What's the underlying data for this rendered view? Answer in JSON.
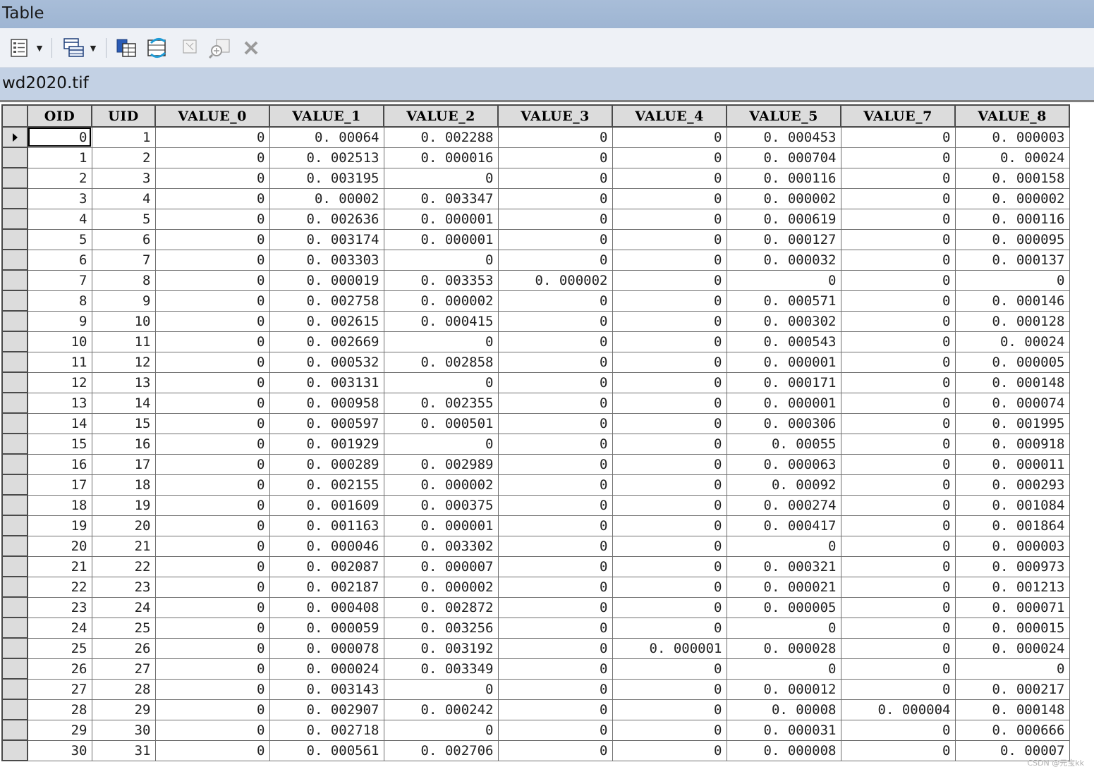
{
  "window": {
    "title": "Table"
  },
  "toolbar": {
    "buttons": [
      {
        "name": "table-options-icon",
        "dropdown": true
      },
      {
        "name": "related-tables-icon",
        "dropdown": true
      },
      {
        "name": "select-by-attributes-icon"
      },
      {
        "name": "switch-selection-icon"
      },
      {
        "name": "clear-selection-icon"
      },
      {
        "name": "zoom-to-selected-icon"
      },
      {
        "name": "delete-selected-icon"
      }
    ]
  },
  "tab": {
    "label": "wd2020.tif"
  },
  "table": {
    "columns": [
      "OID",
      "UID",
      "VALUE_0",
      "VALUE_1",
      "VALUE_2",
      "VALUE_3",
      "VALUE_4",
      "VALUE_5",
      "VALUE_7",
      "VALUE_8"
    ],
    "rows": [
      [
        "0",
        "1",
        "0",
        "0. 00064",
        "0. 002288",
        "0",
        "0",
        "0. 000453",
        "0",
        "0. 000003"
      ],
      [
        "1",
        "2",
        "0",
        "0. 002513",
        "0. 000016",
        "0",
        "0",
        "0. 000704",
        "0",
        "0. 00024"
      ],
      [
        "2",
        "3",
        "0",
        "0. 003195",
        "0",
        "0",
        "0",
        "0. 000116",
        "0",
        "0. 000158"
      ],
      [
        "3",
        "4",
        "0",
        "0. 00002",
        "0. 003347",
        "0",
        "0",
        "0. 000002",
        "0",
        "0. 000002"
      ],
      [
        "4",
        "5",
        "0",
        "0. 002636",
        "0. 000001",
        "0",
        "0",
        "0. 000619",
        "0",
        "0. 000116"
      ],
      [
        "5",
        "6",
        "0",
        "0. 003174",
        "0. 000001",
        "0",
        "0",
        "0. 000127",
        "0",
        "0. 000095"
      ],
      [
        "6",
        "7",
        "0",
        "0. 003303",
        "0",
        "0",
        "0",
        "0. 000032",
        "0",
        "0. 000137"
      ],
      [
        "7",
        "8",
        "0",
        "0. 000019",
        "0. 003353",
        "0. 000002",
        "0",
        "0",
        "0",
        "0"
      ],
      [
        "8",
        "9",
        "0",
        "0. 002758",
        "0. 000002",
        "0",
        "0",
        "0. 000571",
        "0",
        "0. 000146"
      ],
      [
        "9",
        "10",
        "0",
        "0. 002615",
        "0. 000415",
        "0",
        "0",
        "0. 000302",
        "0",
        "0. 000128"
      ],
      [
        "10",
        "11",
        "0",
        "0. 002669",
        "0",
        "0",
        "0",
        "0. 000543",
        "0",
        "0. 00024"
      ],
      [
        "11",
        "12",
        "0",
        "0. 000532",
        "0. 002858",
        "0",
        "0",
        "0. 000001",
        "0",
        "0. 000005"
      ],
      [
        "12",
        "13",
        "0",
        "0. 003131",
        "0",
        "0",
        "0",
        "0. 000171",
        "0",
        "0. 000148"
      ],
      [
        "13",
        "14",
        "0",
        "0. 000958",
        "0. 002355",
        "0",
        "0",
        "0. 000001",
        "0",
        "0. 000074"
      ],
      [
        "14",
        "15",
        "0",
        "0. 000597",
        "0. 000501",
        "0",
        "0",
        "0. 000306",
        "0",
        "0. 001995"
      ],
      [
        "15",
        "16",
        "0",
        "0. 001929",
        "0",
        "0",
        "0",
        "0. 00055",
        "0",
        "0. 000918"
      ],
      [
        "16",
        "17",
        "0",
        "0. 000289",
        "0. 002989",
        "0",
        "0",
        "0. 000063",
        "0",
        "0. 000011"
      ],
      [
        "17",
        "18",
        "0",
        "0. 002155",
        "0. 000002",
        "0",
        "0",
        "0. 00092",
        "0",
        "0. 000293"
      ],
      [
        "18",
        "19",
        "0",
        "0. 001609",
        "0. 000375",
        "0",
        "0",
        "0. 000274",
        "0",
        "0. 001084"
      ],
      [
        "19",
        "20",
        "0",
        "0. 001163",
        "0. 000001",
        "0",
        "0",
        "0. 000417",
        "0",
        "0. 001864"
      ],
      [
        "20",
        "21",
        "0",
        "0. 000046",
        "0. 003302",
        "0",
        "0",
        "0",
        "0",
        "0. 000003"
      ],
      [
        "21",
        "22",
        "0",
        "0. 002087",
        "0. 000007",
        "0",
        "0",
        "0. 000321",
        "0",
        "0. 000973"
      ],
      [
        "22",
        "23",
        "0",
        "0. 002187",
        "0. 000002",
        "0",
        "0",
        "0. 000021",
        "0",
        "0. 001213"
      ],
      [
        "23",
        "24",
        "0",
        "0. 000408",
        "0. 002872",
        "0",
        "0",
        "0. 000005",
        "0",
        "0. 000071"
      ],
      [
        "24",
        "25",
        "0",
        "0. 000059",
        "0. 003256",
        "0",
        "0",
        "0",
        "0",
        "0. 000015"
      ],
      [
        "25",
        "26",
        "0",
        "0. 000078",
        "0. 003192",
        "0",
        "0. 000001",
        "0. 000028",
        "0",
        "0. 000024"
      ],
      [
        "26",
        "27",
        "0",
        "0. 000024",
        "0. 003349",
        "0",
        "0",
        "0",
        "0",
        "0"
      ],
      [
        "27",
        "28",
        "0",
        "0. 003143",
        "0",
        "0",
        "0",
        "0. 000012",
        "0",
        "0. 000217"
      ],
      [
        "28",
        "29",
        "0",
        "0. 002907",
        "0. 000242",
        "0",
        "0",
        "0. 00008",
        "0. 000004",
        "0. 000148"
      ],
      [
        "29",
        "30",
        "0",
        "0. 002718",
        "0",
        "0",
        "0",
        "0. 000031",
        "0",
        "0. 000666"
      ],
      [
        "30",
        "31",
        "0",
        "0. 000561",
        "0. 002706",
        "0",
        "0",
        "0. 000008",
        "0",
        "0. 00007"
      ]
    ]
  },
  "watermark": "CSDN @元宝kk"
}
